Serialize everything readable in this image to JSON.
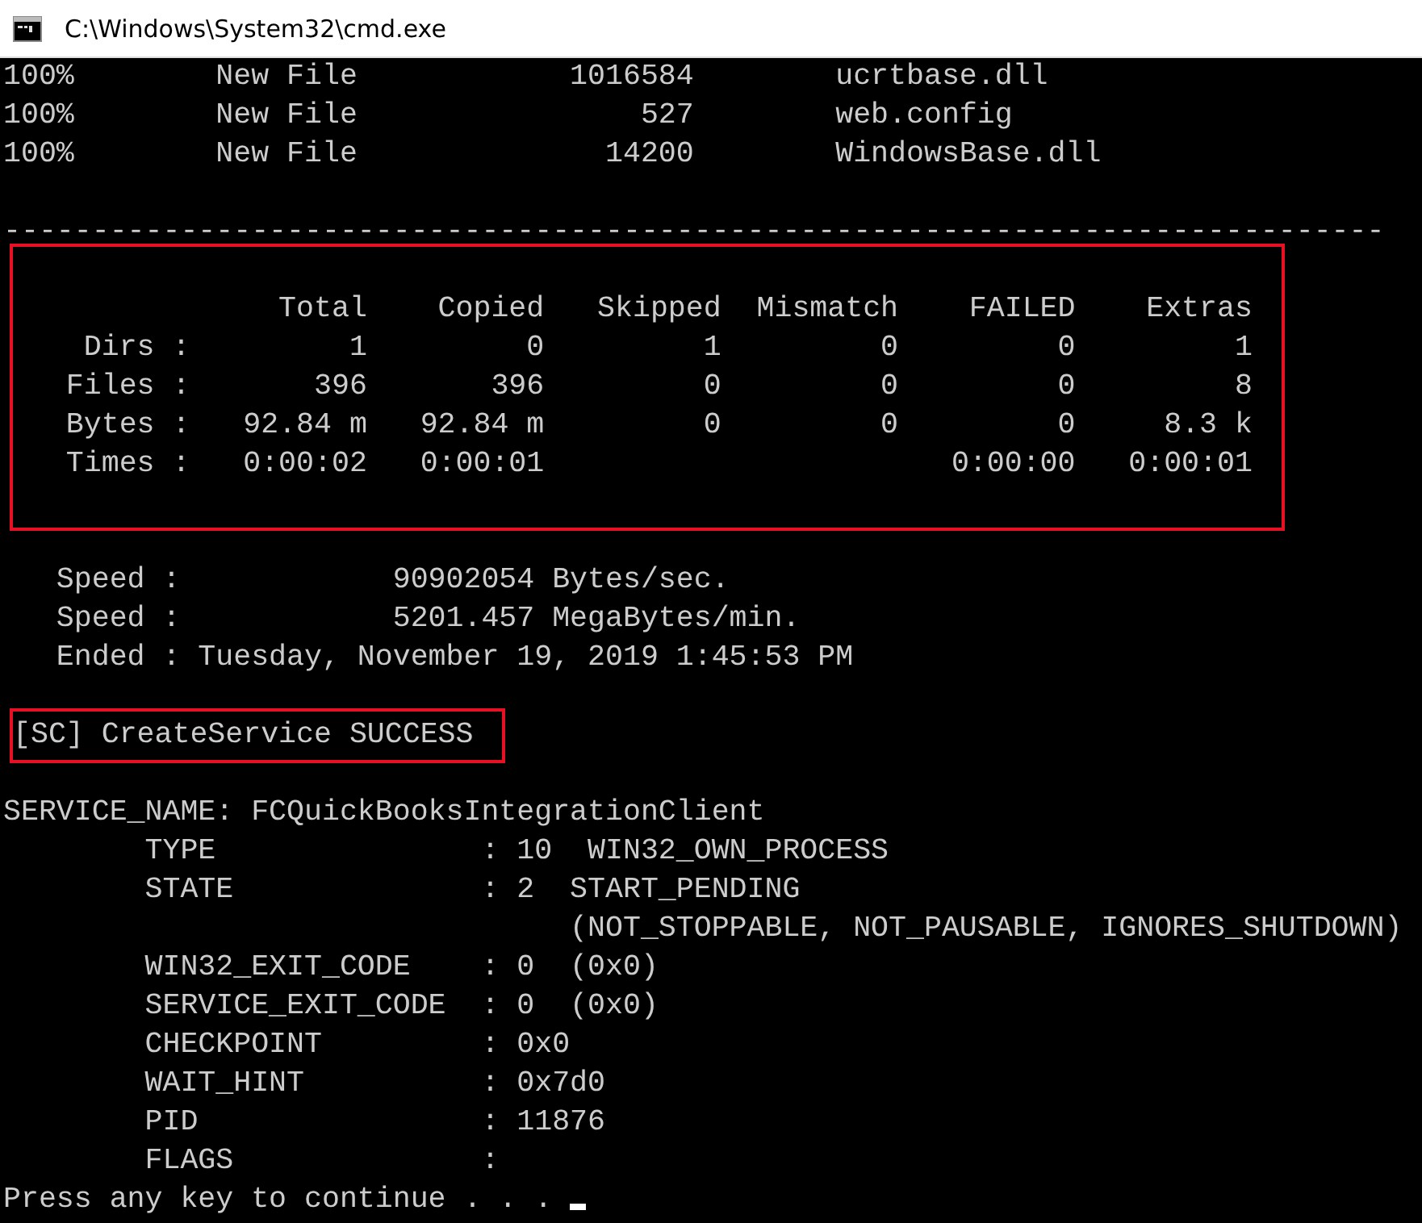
{
  "window": {
    "title": "C:\\Windows\\System32\\cmd.exe"
  },
  "console": {
    "cursor_visible": true,
    "blocks": [
      {
        "highlighted": false,
        "lines": [
          {
            "kind": "text",
            "text": "100%        New File            1016584        ucrtbase.dll"
          },
          {
            "kind": "text",
            "text": "100%        New File                527        web.config"
          },
          {
            "kind": "text",
            "text": "100%        New File              14200        WindowsBase.dll"
          },
          {
            "kind": "blank"
          },
          {
            "kind": "text",
            "text": "------------------------------------------------------------------------------"
          }
        ]
      },
      {
        "highlighted": true,
        "lines": [
          {
            "kind": "blank"
          },
          {
            "kind": "text",
            "text": "               Total    Copied   Skipped  Mismatch    FAILED    Extras"
          },
          {
            "kind": "text",
            "text": "    Dirs :         1         0         1         0         0         1"
          },
          {
            "kind": "text",
            "text": "   Files :       396       396         0         0         0         8"
          },
          {
            "kind": "text",
            "text": "   Bytes :   92.84 m   92.84 m         0         0         0     8.3 k"
          },
          {
            "kind": "text",
            "text": "   Times :   0:00:02   0:00:01                       0:00:00   0:00:01"
          },
          {
            "kind": "blank"
          }
        ]
      },
      {
        "highlighted": false,
        "lines": [
          {
            "kind": "blank"
          },
          {
            "kind": "text",
            "text": "   Speed :            90902054 Bytes/sec."
          },
          {
            "kind": "text",
            "text": "   Speed :            5201.457 MegaBytes/min."
          },
          {
            "kind": "text",
            "text": "   Ended : Tuesday, November 19, 2019 1:45:53 PM"
          },
          {
            "kind": "blank"
          }
        ]
      },
      {
        "highlighted": true,
        "lines": [
          {
            "kind": "text",
            "text": "[SC] CreateService SUCCESS"
          }
        ]
      },
      {
        "highlighted": false,
        "lines": [
          {
            "kind": "blank"
          },
          {
            "kind": "text",
            "text": "SERVICE_NAME: FCQuickBooksIntegrationClient"
          },
          {
            "kind": "text",
            "text": "        TYPE               : 10  WIN32_OWN_PROCESS"
          },
          {
            "kind": "text",
            "text": "        STATE              : 2  START_PENDING"
          },
          {
            "kind": "text",
            "text": "                                (NOT_STOPPABLE, NOT_PAUSABLE, IGNORES_SHUTDOWN)"
          },
          {
            "kind": "text",
            "text": "        WIN32_EXIT_CODE    : 0  (0x0)"
          },
          {
            "kind": "text",
            "text": "        SERVICE_EXIT_CODE  : 0  (0x0)"
          },
          {
            "kind": "text",
            "text": "        CHECKPOINT         : 0x0"
          },
          {
            "kind": "text",
            "text": "        WAIT_HINT          : 0x7d0"
          },
          {
            "kind": "text",
            "text": "        PID                : 11876"
          },
          {
            "kind": "text",
            "text": "        FLAGS              :"
          },
          {
            "kind": "prompt",
            "text": "Press any key to continue . . . "
          }
        ]
      }
    ]
  }
}
